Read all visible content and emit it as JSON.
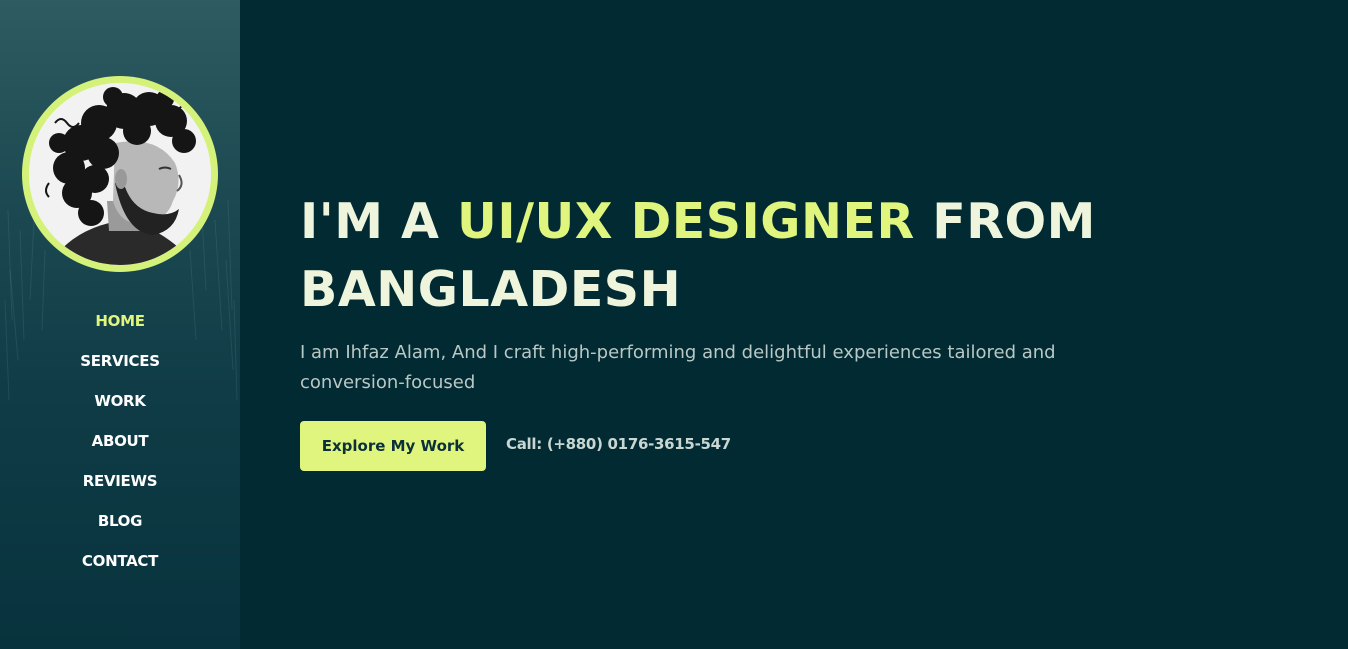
{
  "sidebar": {
    "avatar_alt": "",
    "nav": [
      {
        "label": "HOME",
        "active": true
      },
      {
        "label": "SERVICES",
        "active": false
      },
      {
        "label": "WORK",
        "active": false
      },
      {
        "label": "ABOUT",
        "active": false
      },
      {
        "label": "REVIEWS",
        "active": false
      },
      {
        "label": "BLOG",
        "active": false
      },
      {
        "label": "CONTACT",
        "active": false
      }
    ]
  },
  "hero": {
    "headline_prefix": "I'M A ",
    "headline_accent": "UI/UX DESIGNER",
    "headline_suffix": " FROM BANGLADESH",
    "intro": "I am Ihfaz Alam, And I craft high-performing and delightful experiences tailored and conversion-focused",
    "cta_label": "Explore My Work",
    "phone": "Call: (+880) 0176-3615-547"
  },
  "colors": {
    "background": "#022a33",
    "accent": "#dff57e",
    "heading": "#eef5dc",
    "body_text": "#b9c8c4"
  }
}
